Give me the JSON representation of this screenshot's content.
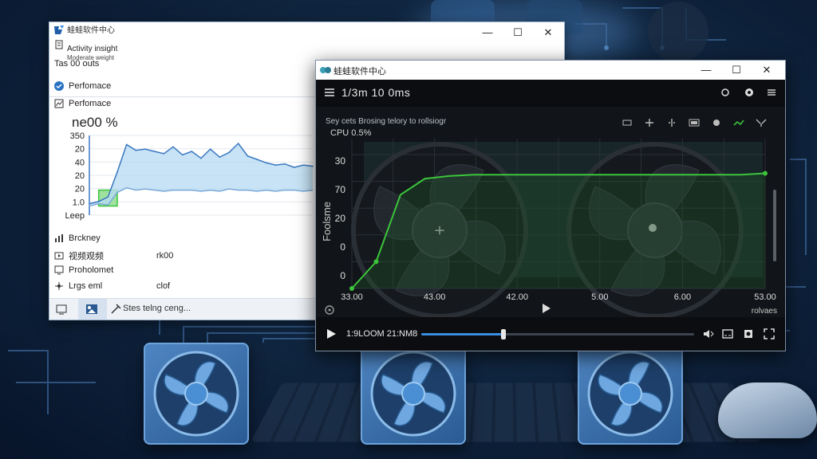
{
  "colors": {
    "accent_blue": "#3a8de0",
    "chart_green": "#3cc43c",
    "tm_line": "#3a77c0",
    "tm_fill": "#b9dcf2"
  },
  "task_manager": {
    "brand": "蛙蛙软件中心",
    "subtitle": "Activity insight",
    "subtitle2": "Moderate weight",
    "tab_label": "Tas  00 outs",
    "nav_performance_1": "Perfomace",
    "nav_performance_2": "Perfomace",
    "big_value": "ne00 %",
    "y_ticks": [
      "350",
      "20",
      "40",
      "20",
      "20",
      "1.0",
      "Leep"
    ],
    "rows": [
      {
        "label": "Brckney",
        "value": "",
        "icon": "chart-icon"
      },
      {
        "label": "视频观频",
        "value": "rk00",
        "icon": "video-icon"
      },
      {
        "label": "Proholomet",
        "value": "",
        "icon": "monitor-icon"
      },
      {
        "label": "Lrgs eml",
        "value": "clof",
        "icon": "network-icon"
      }
    ],
    "footer_text": "Stes telng ceng..."
  },
  "chart_data": [
    {
      "type": "area",
      "title": "ne00 %",
      "xlabel": "",
      "ylabel": "",
      "yticks": [
        "350",
        "20",
        "40",
        "20",
        "20",
        "1.0",
        "Leep"
      ],
      "series": [
        {
          "values": [
            10,
            12,
            16,
            38,
            62,
            57,
            58,
            56,
            54,
            60,
            53,
            56,
            50,
            58,
            51,
            55,
            63,
            52,
            49,
            46,
            44,
            45,
            42,
            44,
            43
          ]
        },
        {
          "values": [
            8,
            10,
            9,
            20,
            24,
            22,
            23,
            22,
            21,
            22,
            22,
            22,
            21,
            22,
            21,
            23,
            22,
            22,
            21,
            22,
            21,
            22,
            22,
            21,
            22
          ]
        }
      ],
      "grid": true
    },
    {
      "type": "line",
      "title": "Sey cets  Brosing telory to  rollsiogr",
      "subtitle": "CPU  0.5%",
      "xlabel": "",
      "ylabel": "Foolsme",
      "x": [
        "33.00",
        "43.00",
        "42.00",
        "5.00",
        "6.00",
        "53.00"
      ],
      "yticks": [
        "30",
        "70",
        "20",
        "0",
        "0"
      ],
      "series": [
        {
          "values": [
            0,
            20,
            70,
            82,
            84,
            85,
            85,
            85,
            85,
            85,
            85,
            85,
            85,
            85,
            85,
            85,
            85,
            86
          ]
        }
      ],
      "grid": true
    }
  ],
  "player": {
    "title": "蛙蛙软件中心",
    "timer": "1/3m  10 0ms",
    "overlay_title": "Sey cets  Brosing telory to  rollsiogr",
    "cpu": "CPU  0.5%",
    "ylabel": "Foolsme",
    "bottom_right": "rolvaes",
    "current_time": "1:9LOOM  21:NM8",
    "progress": 0.3
  }
}
